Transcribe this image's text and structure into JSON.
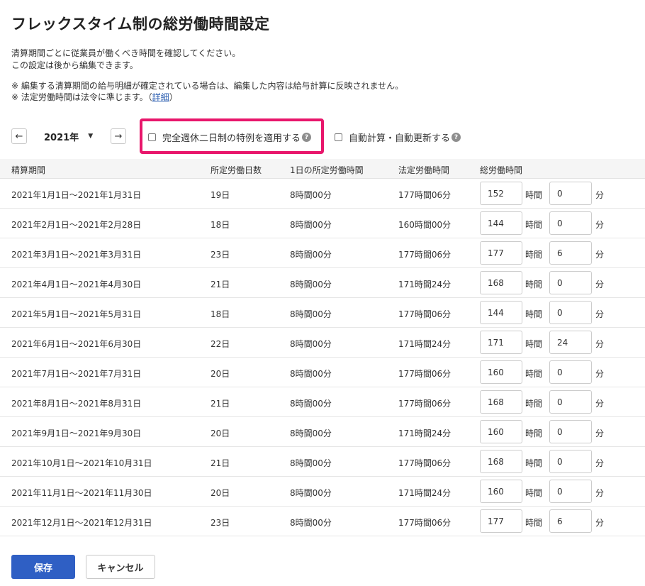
{
  "page": {
    "title": "フレックスタイム制の総労働時間設定",
    "desc_line1": "清算期間ごとに従業員が働くべき時間を確認してください。",
    "desc_line2": "この設定は後から編集できます。",
    "note_line1": "※ 編集する清算期間の給与明細が確定されている場合は、編集した内容は給与計算に反映されません。",
    "note_line2_prefix": "※ 法定労働時間は法令に準じます。（",
    "note_line2_link": "詳細",
    "note_line2_suffix": "）"
  },
  "controls": {
    "prev_label": "←",
    "next_label": "→",
    "year": "2021年",
    "caret": "▼",
    "option1_label": "完全週休二日制の特例を適用する",
    "option2_label": "自動計算・自動更新する",
    "help_glyph": "?"
  },
  "table": {
    "headers": [
      "精算期間",
      "所定労働日数",
      "1日の所定労働時間",
      "法定労働時間",
      "総労働時間"
    ],
    "unit_hour": "時間",
    "unit_min": "分",
    "rows": [
      {
        "period": "2021年1月1日～2021年1月31日",
        "days": "19日",
        "daily": "8時間00分",
        "legal": "177時間06分",
        "hours": "152",
        "minutes": "0"
      },
      {
        "period": "2021年2月1日～2021年2月28日",
        "days": "18日",
        "daily": "8時間00分",
        "legal": "160時間00分",
        "hours": "144",
        "minutes": "0"
      },
      {
        "period": "2021年3月1日～2021年3月31日",
        "days": "23日",
        "daily": "8時間00分",
        "legal": "177時間06分",
        "hours": "177",
        "minutes": "6"
      },
      {
        "period": "2021年4月1日～2021年4月30日",
        "days": "21日",
        "daily": "8時間00分",
        "legal": "171時間24分",
        "hours": "168",
        "minutes": "0"
      },
      {
        "period": "2021年5月1日～2021年5月31日",
        "days": "18日",
        "daily": "8時間00分",
        "legal": "177時間06分",
        "hours": "144",
        "minutes": "0"
      },
      {
        "period": "2021年6月1日～2021年6月30日",
        "days": "22日",
        "daily": "8時間00分",
        "legal": "171時間24分",
        "hours": "171",
        "minutes": "24"
      },
      {
        "period": "2021年7月1日～2021年7月31日",
        "days": "20日",
        "daily": "8時間00分",
        "legal": "177時間06分",
        "hours": "160",
        "minutes": "0"
      },
      {
        "period": "2021年8月1日～2021年8月31日",
        "days": "21日",
        "daily": "8時間00分",
        "legal": "177時間06分",
        "hours": "168",
        "minutes": "0"
      },
      {
        "period": "2021年9月1日～2021年9月30日",
        "days": "20日",
        "daily": "8時間00分",
        "legal": "171時間24分",
        "hours": "160",
        "minutes": "0"
      },
      {
        "period": "2021年10月1日～2021年10月31日",
        "days": "21日",
        "daily": "8時間00分",
        "legal": "177時間06分",
        "hours": "168",
        "minutes": "0"
      },
      {
        "period": "2021年11月1日～2021年11月30日",
        "days": "20日",
        "daily": "8時間00分",
        "legal": "171時間24分",
        "hours": "160",
        "minutes": "0"
      },
      {
        "period": "2021年12月1日～2021年12月31日",
        "days": "23日",
        "daily": "8時間00分",
        "legal": "177時間06分",
        "hours": "177",
        "minutes": "6"
      }
    ]
  },
  "footer": {
    "save_label": "保存",
    "cancel_label": "キャンセル"
  },
  "colors": {
    "primary": "#2f5fc4",
    "highlight": "#e8166b",
    "header_bg": "#f5f5f5",
    "link": "#2a5db0"
  }
}
